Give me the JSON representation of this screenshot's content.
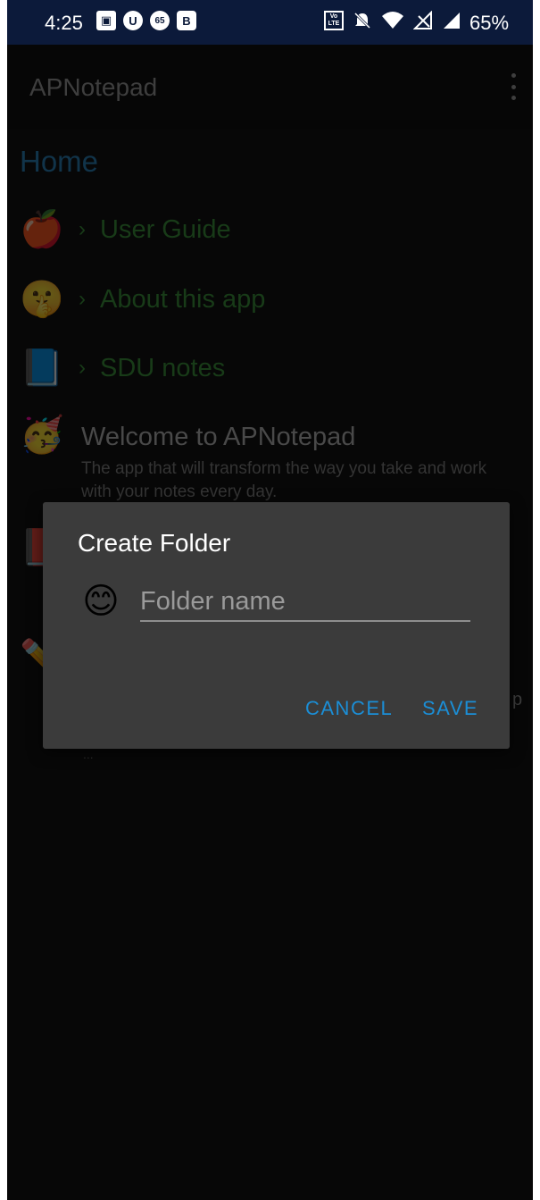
{
  "status_bar": {
    "time": "4:25",
    "left_icons": [
      {
        "name": "gallery-icon",
        "glyph": "▣"
      },
      {
        "name": "u-app-icon",
        "glyph": "U"
      },
      {
        "name": "sixty-five-icon",
        "glyph": "65"
      },
      {
        "name": "b-app-icon",
        "glyph": "B"
      }
    ],
    "right_icons": [
      "volte-icon",
      "mute-icon",
      "wifi-icon",
      "no-sim-icon",
      "signal-icon"
    ],
    "volte_label": "Vo LTE",
    "battery": "65%"
  },
  "app_bar": {
    "title": "APNotepad"
  },
  "home": {
    "title": "Home",
    "items": [
      {
        "emoji": "🍎",
        "label": "User Guide"
      },
      {
        "emoji": "🤫",
        "label": "About this app"
      },
      {
        "emoji": "📘",
        "label": "SDU notes"
      }
    ],
    "note": {
      "emoji": "🥳",
      "title": "Welcome to APNotepad",
      "subtitle": "The app that will transform the way you take and work with your notes every day."
    },
    "partial_items": [
      {
        "emoji": "📕"
      },
      {
        "emoji": "✏️"
      }
    ],
    "peek_text": "p",
    "peek_ellipsis": "..."
  },
  "dialog": {
    "title": "Create Folder",
    "emoji": "😊",
    "input": {
      "placeholder": "Folder name",
      "value": ""
    },
    "cancel_label": "CANCEL",
    "save_label": "SAVE"
  },
  "colors": {
    "accent": "#1b8ed6",
    "status_bar": "#0c1a3a",
    "link_dim": "#183b18"
  }
}
